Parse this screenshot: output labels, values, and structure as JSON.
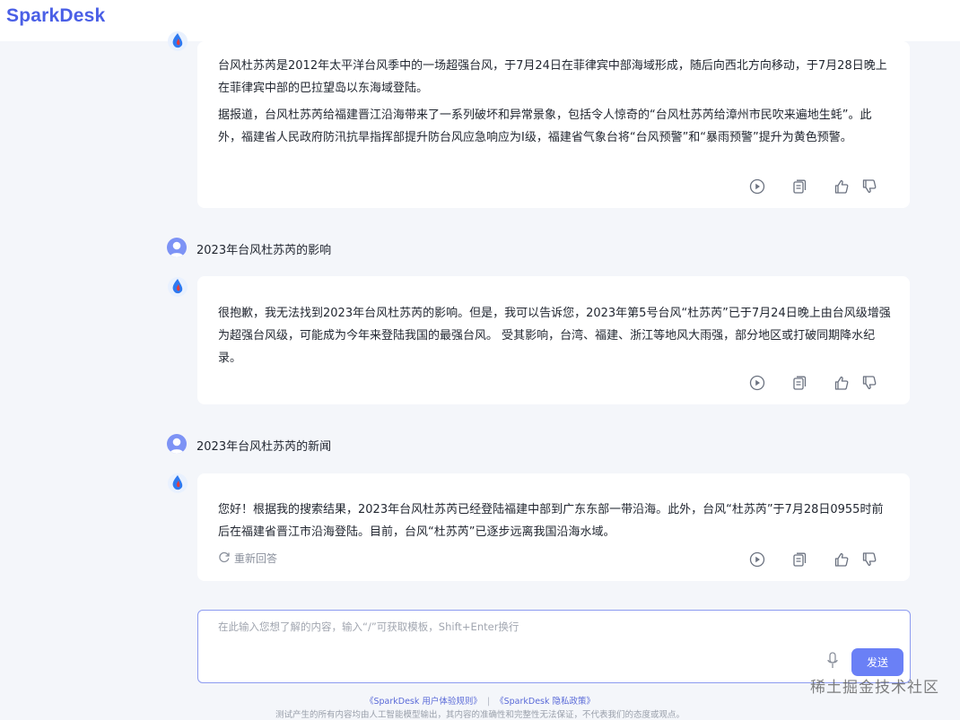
{
  "app": {
    "logo": "SparkDesk"
  },
  "messages": [
    {
      "answer_paragraphs": [
        "台风杜苏芮是2012年太平洋台风季中的一场超强台风，于7月24日在菲律宾中部海域形成，随后向西北方向移动，于7月28日晚上在菲律宾中部的巴拉望岛以东海域登陆。",
        "据报道，台风杜苏芮给福建晋江沿海带来了一系列破坏和异常景象，包括令人惊奇的“台风杜苏芮给漳州市民吹来遍地生蚝”。此外，福建省人民政府防汛抗旱指挥部提升防台风应急响应为Ⅰ级，福建省气象台将“台风预警”和“暴雨预警”提升为黄色预警。"
      ]
    },
    {
      "question": "2023年台风杜苏芮的影响",
      "answer_paragraphs": [
        "很抱歉，我无法找到2023年台风杜苏芮的影响。但是，我可以告诉您，2023年第5号台风“杜苏芮”已于7月24日晚上由台风级增强为超强台风级，可能成为今年来登陆我国的最强台风。 受其影响，台湾、福建、浙江等地风大雨强，部分地区或打破同期降水纪录。"
      ]
    },
    {
      "question": "2023年台风杜苏芮的新闻",
      "answer_paragraphs": [
        "您好！根据我的搜索结果，2023年台风杜苏芮已经登陆福建中部到广东东部一带沿海。此外，台风“杜苏芮”于7月28日0955时前后在福建省晋江市沿海登陆。目前，台风“杜苏芮”已逐步远离我国沿海水域。"
      ],
      "regenerate_label": "重新回答"
    }
  ],
  "input": {
    "placeholder": "在此输入您想了解的内容，输入“/”可获取模板，Shift+Enter换行",
    "value": "",
    "send_label": "发送"
  },
  "footer": {
    "link_user_rules": "《SparkDesk 用户体验规则》",
    "separator": "|",
    "link_privacy": "《SparkDesk 隐私政策》",
    "note": "测试产生的所有内容均由人工智能模型输出，其内容的准确性和完整性无法保证，不代表我们的态度或观点。"
  },
  "overlay_watermark": "稀土掘金技术社区",
  "icons": {
    "bot_avatar": "spark-logo-icon",
    "user_avatar": "user-avatar-icon",
    "play": "play-icon",
    "copy": "copy-icon",
    "like": "thumbs-up-icon",
    "dislike": "thumbs-down-icon",
    "regen": "refresh-icon",
    "mic": "microphone-icon"
  },
  "colors": {
    "accent": "#6a80f6",
    "brand": "#4a5fe6",
    "bg": "#f4f6fa"
  }
}
